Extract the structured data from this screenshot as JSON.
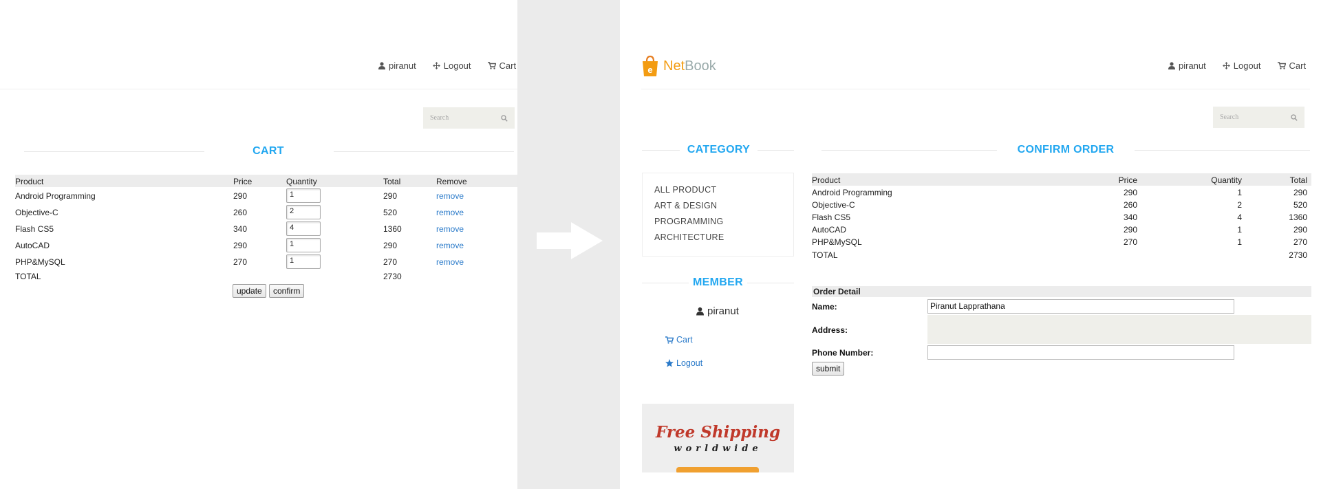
{
  "header": {
    "user": "piranut",
    "logout": "Logout",
    "cart": "Cart"
  },
  "search": {
    "placeholder": "Search"
  },
  "cart_page": {
    "title": "CART",
    "columns": [
      "Product",
      "Price",
      "Quantity",
      "Total",
      "Remove"
    ],
    "rows": [
      {
        "product": "Android Programming",
        "price": "290",
        "qty": "1",
        "total": "290",
        "remove": "remove"
      },
      {
        "product": "Objective-C",
        "price": "260",
        "qty": "2",
        "total": "520",
        "remove": "remove"
      },
      {
        "product": "Flash CS5",
        "price": "340",
        "qty": "4",
        "total": "1360",
        "remove": "remove"
      },
      {
        "product": "AutoCAD",
        "price": "290",
        "qty": "1",
        "total": "290",
        "remove": "remove"
      },
      {
        "product": "PHP&MySQL",
        "price": "270",
        "qty": "1",
        "total": "270",
        "remove": "remove"
      }
    ],
    "total_label": "TOTAL",
    "total_value": "2730",
    "update_label": "update",
    "confirm_label": "confirm"
  },
  "brand": {
    "name_a": "Net",
    "name_b": "Book",
    "logo_letter": "e"
  },
  "category": {
    "title": "CATEGORY",
    "items": [
      "ALL PRODUCT",
      "ART & DESIGN",
      "PROGRAMMING",
      "ARCHITECTURE"
    ]
  },
  "member": {
    "title": "MEMBER",
    "name": "piranut",
    "cart": "Cart",
    "logout": "Logout"
  },
  "promo": {
    "line1": "Free Shipping",
    "line2": "worldwide"
  },
  "confirm_page": {
    "title": "CONFIRM ORDER",
    "columns": [
      "Product",
      "Price",
      "Quantity",
      "Total"
    ],
    "rows": [
      {
        "product": "Android Programming",
        "price": "290",
        "qty": "1",
        "total": "290"
      },
      {
        "product": "Objective-C",
        "price": "260",
        "qty": "2",
        "total": "520"
      },
      {
        "product": "Flash CS5",
        "price": "340",
        "qty": "4",
        "total": "1360"
      },
      {
        "product": "AutoCAD",
        "price": "290",
        "qty": "1",
        "total": "290"
      },
      {
        "product": "PHP&MySQL",
        "price": "270",
        "qty": "1",
        "total": "270"
      }
    ],
    "total_label": "TOTAL",
    "total_value": "2730",
    "order_detail": "Order Detail",
    "name_label": "Name:",
    "name_value": "Piranut Lapprathana",
    "address_label": "Address:",
    "phone_label": "Phone Number:",
    "submit_label": "submit"
  },
  "colors": {
    "accent": "#22a7f0",
    "link": "#2a7ac9",
    "brand_orange": "#f39c12"
  }
}
